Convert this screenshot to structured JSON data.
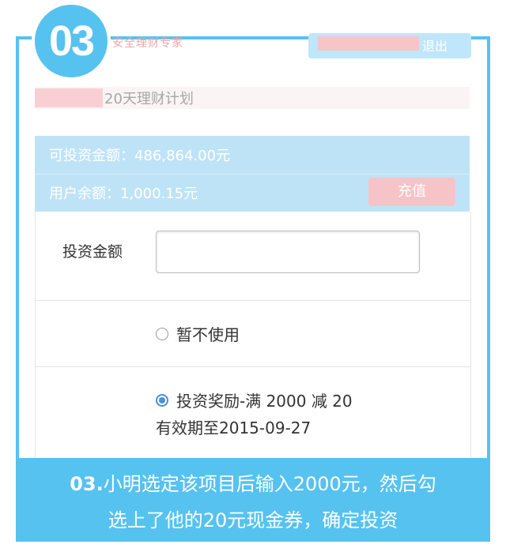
{
  "step_badge": "03",
  "header": {
    "logo_text": "安全理财专家",
    "logout_label": "退出"
  },
  "plan": {
    "title": "20天理财计划"
  },
  "balance": {
    "investable": "可投资金额：486,864.00元",
    "user_balance": "用户余额：1,000.15元",
    "recharge_label": "充值"
  },
  "form": {
    "amount_label": "投资金额",
    "amount_value": "",
    "option_none": "暂不使用",
    "option_coupon": "投资奖励-满 2000 减 20",
    "coupon_expiry": "有效期至2015-09-27"
  },
  "caption": {
    "step": "03.",
    "text_line1": "小明选定该项目后输入2000元，然后勾",
    "text_line2": "选上了他的20元现金券，确定投资"
  },
  "colors": {
    "accent": "#56c2f0",
    "balance_panel": "#bfe3f6",
    "recharge_button": "#f6c3c7",
    "radio_checked": "#4a90d9"
  }
}
